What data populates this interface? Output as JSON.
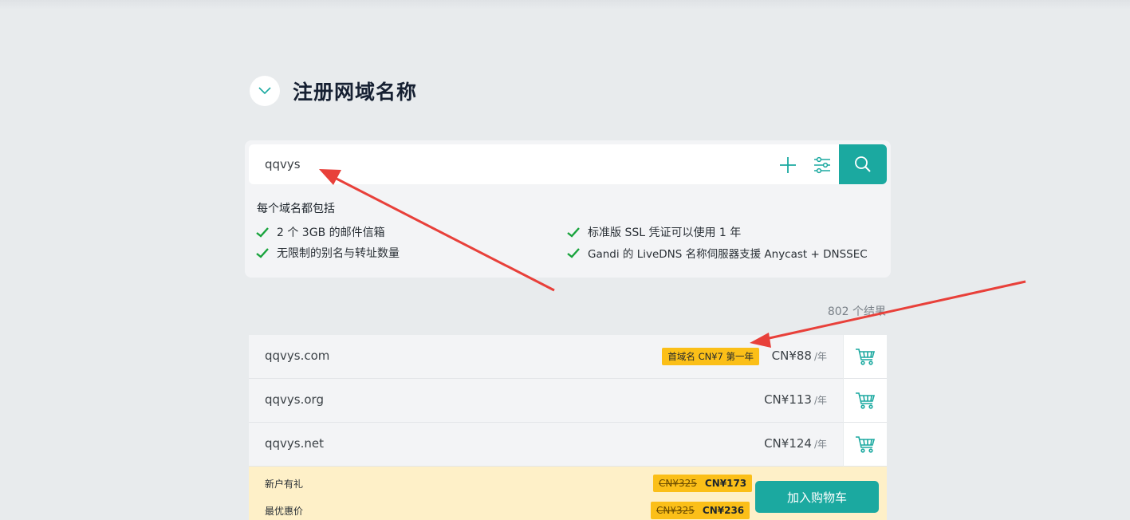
{
  "page": {
    "title": "注册网域名称"
  },
  "search": {
    "value": "qqvys",
    "placeholder": ""
  },
  "includes": {
    "title": "每个域名都包括",
    "features": [
      "2 个 3GB 的邮件信箱",
      "无限制的别名与转址数量",
      "标准版 SSL 凭证可以使用 1 年",
      "Gandi 的 LiveDNS 名称伺服器支援 Anycast + DNSSEC"
    ]
  },
  "results": {
    "count_text": "802 个结果",
    "rows": [
      {
        "domain": "qqvys.com",
        "promo": "首域名 CN¥7 第一年",
        "price": "CN¥88",
        "unit": "/年"
      },
      {
        "domain": "qqvys.org",
        "promo": "",
        "price": "CN¥113",
        "unit": "/年"
      },
      {
        "domain": "qqvys.net",
        "promo": "",
        "price": "CN¥124",
        "unit": "/年"
      }
    ]
  },
  "deals": {
    "items": [
      {
        "label": "新户有礼",
        "old_price": "CN¥325",
        "new_price": "CN¥173"
      },
      {
        "label": "最优惠价",
        "old_price": "CN¥325",
        "new_price": "CN¥236"
      }
    ],
    "add_to_cart_label": "加入购物车"
  },
  "colors": {
    "accent": "#1ba9a0",
    "promo": "#fbbf18",
    "annotation_arrow": "#e8403a"
  },
  "icons": [
    "chevron-down-icon",
    "plus-icon",
    "filter-sliders-icon",
    "search-icon",
    "check-icon",
    "cart-icon"
  ]
}
